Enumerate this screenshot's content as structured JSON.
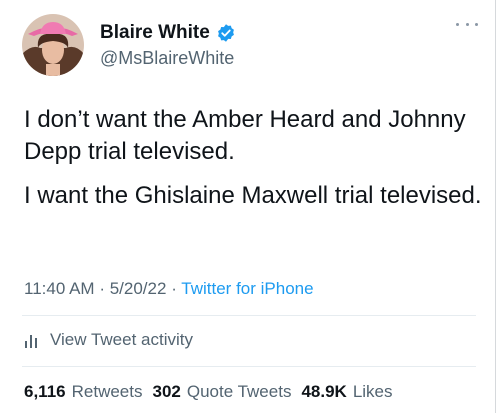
{
  "profile": {
    "display_name": "Blaire White",
    "handle": "@MsBlaireWhite",
    "verified_icon": "verified-badge-icon"
  },
  "tweet": {
    "paragraphs": [
      "I don’t want the Amber Heard and Johnny Depp trial televised.",
      "I want the Ghislaine Maxwell trial televised."
    ]
  },
  "meta": {
    "time": "11:40 AM",
    "separator": "·",
    "date": "5/20/22",
    "source": "Twitter for iPhone"
  },
  "activity": {
    "label": "View Tweet activity",
    "icon": "bar-chart-icon"
  },
  "stats": {
    "retweets_count": "6,116",
    "retweets_label": "Retweets",
    "quote_count": "302",
    "quote_label": "Quote Tweets",
    "likes_count": "48.9K",
    "likes_label": "Likes"
  },
  "colors": {
    "link": "#1d9bf0",
    "secondary": "#536471",
    "primary": "#0f1419"
  }
}
